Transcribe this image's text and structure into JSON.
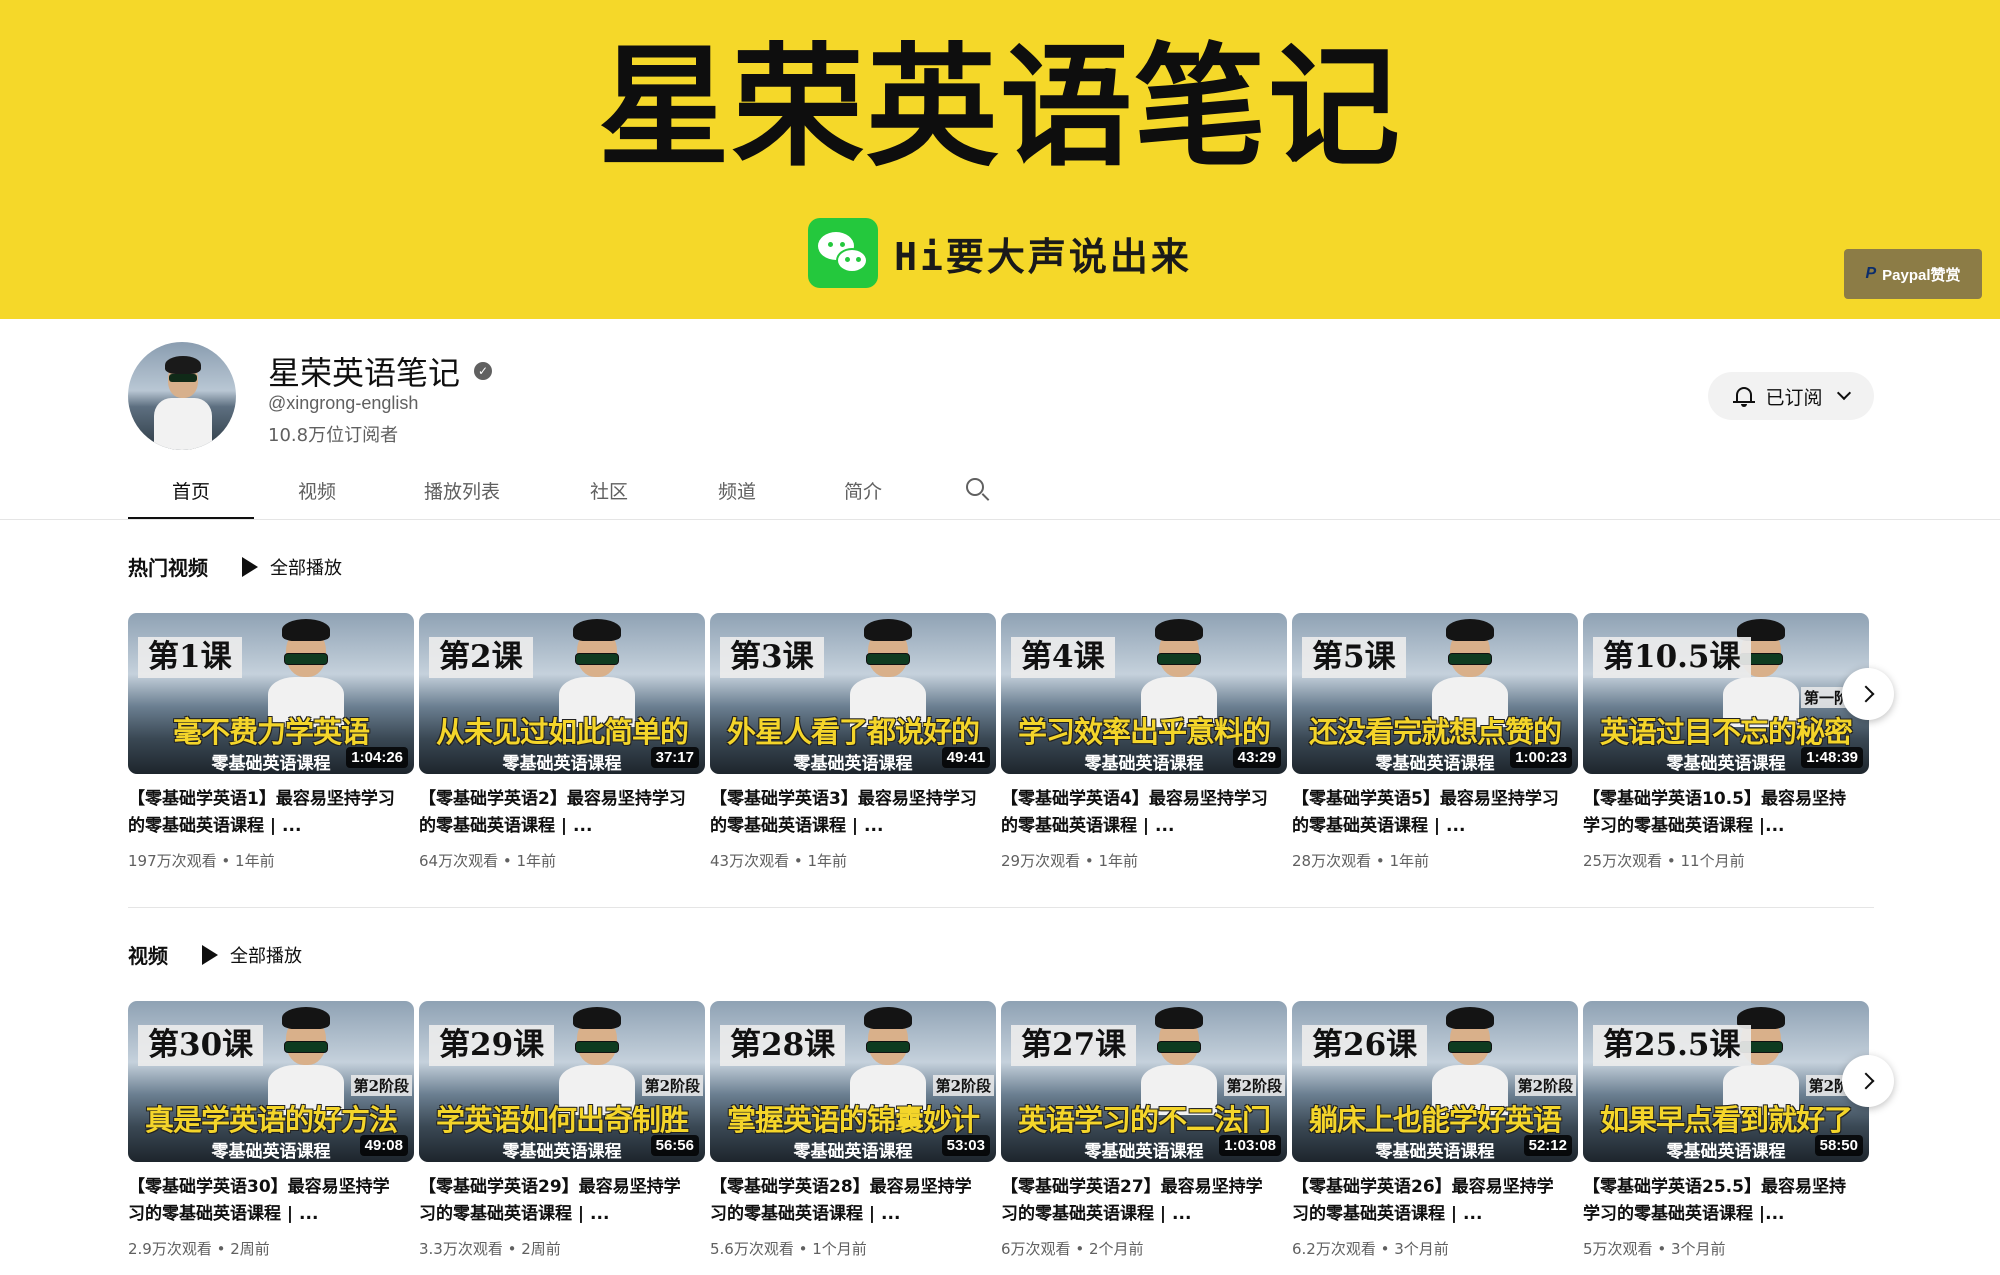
{
  "banner": {
    "title": "星荣英语笔记",
    "wechat_text": "Hi要大声说出来",
    "paypal_label": "Paypal赞赏"
  },
  "channel": {
    "name": "星荣英语笔记",
    "handle": "@xingrong-english",
    "subscribers": "10.8万位订阅者",
    "subscribe_label": "已订阅"
  },
  "tabs": [
    {
      "label": "首页",
      "active": true
    },
    {
      "label": "视频",
      "active": false
    },
    {
      "label": "播放列表",
      "active": false
    },
    {
      "label": "社区",
      "active": false
    },
    {
      "label": "频道",
      "active": false
    },
    {
      "label": "简介",
      "active": false
    }
  ],
  "popular": {
    "title": "热门视频",
    "play_all": "全部播放",
    "videos": [
      {
        "lesson": "第1课",
        "tagline": "毫不费力学英语",
        "course": "零基础英语课程",
        "stage": "",
        "duration": "1:04:26",
        "title": "【零基础学英语1】最容易坚持学习的零基础英语课程 | ...",
        "views": "197万次观看",
        "age": "1年前"
      },
      {
        "lesson": "第2课",
        "tagline": "从未见过如此简单的",
        "course": "零基础英语课程",
        "stage": "",
        "duration": "37:17",
        "title": "【零基础学英语2】最容易坚持学习的零基础英语课程 | ...",
        "views": "64万次观看",
        "age": "1年前"
      },
      {
        "lesson": "第3课",
        "tagline": "外星人看了都说好的",
        "course": "零基础英语课程",
        "stage": "",
        "duration": "49:41",
        "title": "【零基础学英语3】最容易坚持学习的零基础英语课程 | ...",
        "views": "43万次观看",
        "age": "1年前"
      },
      {
        "lesson": "第4课",
        "tagline": "学习效率出乎意料的",
        "course": "零基础英语课程",
        "stage": "",
        "duration": "43:29",
        "title": "【零基础学英语4】最容易坚持学习的零基础英语课程 | ...",
        "views": "29万次观看",
        "age": "1年前"
      },
      {
        "lesson": "第5课",
        "tagline": "还没看完就想点赞的",
        "course": "零基础英语课程",
        "stage": "",
        "duration": "1:00:23",
        "title": "【零基础学英语5】最容易坚持学习的零基础英语课程 | ...",
        "views": "28万次观看",
        "age": "1年前"
      },
      {
        "lesson": "第10.5课",
        "tagline": "英语过目不忘的秘密",
        "course": "零基础英语课程",
        "stage": "第一阶段",
        "duration": "1:48:39",
        "title": "【零基础学英语10.5】最容易坚持学习的零基础英语课程 |...",
        "views": "25万次观看",
        "age": "11个月前"
      }
    ]
  },
  "latest": {
    "title": "视频",
    "play_all": "全部播放",
    "videos": [
      {
        "lesson": "第30课",
        "tagline": "真是学英语的好方法",
        "course": "零基础英语课程",
        "stage": "第2阶段",
        "duration": "49:08",
        "title": "【零基础学英语30】最容易坚持学习的零基础英语课程 | ...",
        "views": "2.9万次观看",
        "age": "2周前"
      },
      {
        "lesson": "第29课",
        "tagline": "学英语如何出奇制胜",
        "course": "零基础英语课程",
        "stage": "第2阶段",
        "duration": "56:56",
        "title": "【零基础学英语29】最容易坚持学习的零基础英语课程 | ...",
        "views": "3.3万次观看",
        "age": "2周前"
      },
      {
        "lesson": "第28课",
        "tagline": "掌握英语的锦囊妙计",
        "course": "零基础英语课程",
        "stage": "第2阶段",
        "duration": "53:03",
        "title": "【零基础学英语28】最容易坚持学习的零基础英语课程 | ...",
        "views": "5.6万次观看",
        "age": "1个月前"
      },
      {
        "lesson": "第27课",
        "tagline": "英语学习的不二法门",
        "course": "零基础英语课程",
        "stage": "第2阶段",
        "duration": "1:03:08",
        "title": "【零基础学英语27】最容易坚持学习的零基础英语课程 | ...",
        "views": "6万次观看",
        "age": "2个月前"
      },
      {
        "lesson": "第26课",
        "tagline": "躺床上也能学好英语",
        "course": "零基础英语课程",
        "stage": "第2阶段",
        "duration": "52:12",
        "title": "【零基础学英语26】最容易坚持学习的零基础英语课程 | ...",
        "views": "6.2万次观看",
        "age": "3个月前"
      },
      {
        "lesson": "第25.5课",
        "tagline": "如果早点看到就好了",
        "course": "零基础英语课程",
        "stage": "第2阶段",
        "duration": "58:50",
        "title": "【零基础学英语25.5】最容易坚持学习的零基础英语课程 |...",
        "views": "5万次观看",
        "age": "3个月前"
      }
    ]
  },
  "colors": {
    "banner_bg": "#f5d829",
    "tagline_yellow": "#f4d52a",
    "wechat_green": "#24c83d",
    "subscribe_bg": "#f2f2f2"
  },
  "icons": {
    "wechat": "wechat-icon",
    "paypal": "paypal-icon",
    "verified": "verified-check-icon",
    "bell": "bell-icon",
    "chevron": "chevron-down-icon",
    "search": "search-icon",
    "play": "play-icon",
    "next": "chevron-right-icon"
  }
}
